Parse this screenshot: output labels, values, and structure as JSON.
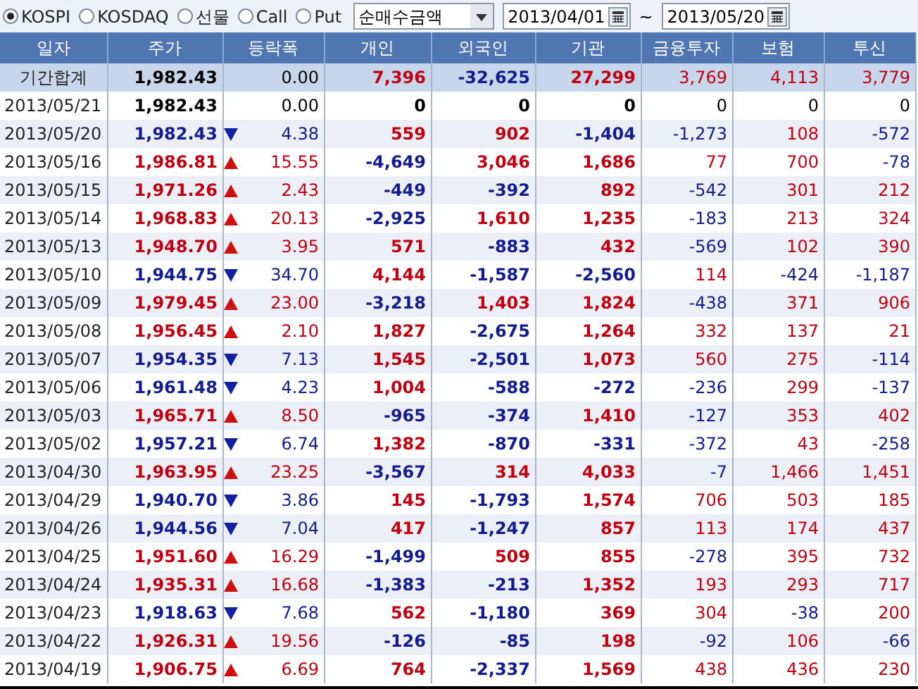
{
  "toolbar": {
    "markets": [
      {
        "label": "KOSPI",
        "selected": true
      },
      {
        "label": "KOSDAQ",
        "selected": false
      },
      {
        "label": "선물",
        "selected": false
      },
      {
        "label": "Call",
        "selected": false
      },
      {
        "label": "Put",
        "selected": false
      }
    ],
    "measure": {
      "value": "순매수금액"
    },
    "start_date": {
      "value": "2013/04/01"
    },
    "separator": "~",
    "end_date": {
      "value": "2013/05/20"
    }
  },
  "table": {
    "columns": [
      "일자",
      "주가",
      "등락폭",
      "개인",
      "외국인",
      "기관",
      "금융투자",
      "보험",
      "투신"
    ],
    "rows": [
      {
        "kind": "total",
        "date": "기간합계",
        "price": "1,982.43",
        "rising": false,
        "falling": false,
        "change": "0.00",
        "flows": [
          {
            "value": "7,396",
            "color": "#c00010"
          },
          {
            "value": "-32,625",
            "color": "#101c90"
          },
          {
            "value": "27,299",
            "color": "#c00010"
          },
          {
            "value": "3,769",
            "color": "#c00010"
          },
          {
            "value": "4,113",
            "color": "#c00010"
          },
          {
            "value": "3,779",
            "color": "#c00010"
          }
        ]
      },
      {
        "kind": "day",
        "date": "2013/05/21",
        "price": "1,982.43",
        "rising": false,
        "falling": false,
        "change": "0.00",
        "flows": [
          {
            "value": "0",
            "color": "#000000"
          },
          {
            "value": "0",
            "color": "#000000"
          },
          {
            "value": "0",
            "color": "#000000"
          },
          {
            "value": "0",
            "color": "#000000"
          },
          {
            "value": "0",
            "color": "#000000"
          },
          {
            "value": "0",
            "color": "#000000"
          }
        ]
      },
      {
        "kind": "day",
        "date": "2013/05/20",
        "price": "1,982.43",
        "rising": false,
        "falling": true,
        "change": "4.38",
        "flows": [
          {
            "value": "559",
            "color": "#c00010"
          },
          {
            "value": "902",
            "color": "#c00010"
          },
          {
            "value": "-1,404",
            "color": "#101c90"
          },
          {
            "value": "-1,273",
            "color": "#101c90"
          },
          {
            "value": "108",
            "color": "#c00010"
          },
          {
            "value": "-572",
            "color": "#101c90"
          }
        ]
      },
      {
        "kind": "day",
        "date": "2013/05/16",
        "price": "1,986.81",
        "rising": true,
        "falling": false,
        "change": "15.55",
        "flows": [
          {
            "value": "-4,649",
            "color": "#101c90"
          },
          {
            "value": "3,046",
            "color": "#c00010"
          },
          {
            "value": "1,686",
            "color": "#c00010"
          },
          {
            "value": "77",
            "color": "#c00010"
          },
          {
            "value": "700",
            "color": "#c00010"
          },
          {
            "value": "-78",
            "color": "#101c90"
          }
        ]
      },
      {
        "kind": "day",
        "date": "2013/05/15",
        "price": "1,971.26",
        "rising": true,
        "falling": false,
        "change": "2.43",
        "flows": [
          {
            "value": "-449",
            "color": "#101c90"
          },
          {
            "value": "-392",
            "color": "#101c90"
          },
          {
            "value": "892",
            "color": "#c00010"
          },
          {
            "value": "-542",
            "color": "#101c90"
          },
          {
            "value": "301",
            "color": "#c00010"
          },
          {
            "value": "212",
            "color": "#c00010"
          }
        ]
      },
      {
        "kind": "day",
        "date": "2013/05/14",
        "price": "1,968.83",
        "rising": true,
        "falling": false,
        "change": "20.13",
        "flows": [
          {
            "value": "-2,925",
            "color": "#101c90"
          },
          {
            "value": "1,610",
            "color": "#c00010"
          },
          {
            "value": "1,235",
            "color": "#c00010"
          },
          {
            "value": "-183",
            "color": "#101c90"
          },
          {
            "value": "213",
            "color": "#c00010"
          },
          {
            "value": "324",
            "color": "#c00010"
          }
        ]
      },
      {
        "kind": "day",
        "date": "2013/05/13",
        "price": "1,948.70",
        "rising": true,
        "falling": false,
        "change": "3.95",
        "flows": [
          {
            "value": "571",
            "color": "#c00010"
          },
          {
            "value": "-883",
            "color": "#101c90"
          },
          {
            "value": "432",
            "color": "#c00010"
          },
          {
            "value": "-569",
            "color": "#101c90"
          },
          {
            "value": "102",
            "color": "#c00010"
          },
          {
            "value": "390",
            "color": "#c00010"
          }
        ]
      },
      {
        "kind": "day",
        "date": "2013/05/10",
        "price": "1,944.75",
        "rising": false,
        "falling": true,
        "change": "34.70",
        "flows": [
          {
            "value": "4,144",
            "color": "#c00010"
          },
          {
            "value": "-1,587",
            "color": "#101c90"
          },
          {
            "value": "-2,560",
            "color": "#101c90"
          },
          {
            "value": "114",
            "color": "#c00010"
          },
          {
            "value": "-424",
            "color": "#101c90"
          },
          {
            "value": "-1,187",
            "color": "#101c90"
          }
        ]
      },
      {
        "kind": "day",
        "date": "2013/05/09",
        "price": "1,979.45",
        "rising": true,
        "falling": false,
        "change": "23.00",
        "flows": [
          {
            "value": "-3,218",
            "color": "#101c90"
          },
          {
            "value": "1,403",
            "color": "#c00010"
          },
          {
            "value": "1,824",
            "color": "#c00010"
          },
          {
            "value": "-438",
            "color": "#101c90"
          },
          {
            "value": "371",
            "color": "#c00010"
          },
          {
            "value": "906",
            "color": "#c00010"
          }
        ]
      },
      {
        "kind": "day",
        "date": "2013/05/08",
        "price": "1,956.45",
        "rising": true,
        "falling": false,
        "change": "2.10",
        "flows": [
          {
            "value": "1,827",
            "color": "#c00010"
          },
          {
            "value": "-2,675",
            "color": "#101c90"
          },
          {
            "value": "1,264",
            "color": "#c00010"
          },
          {
            "value": "332",
            "color": "#c00010"
          },
          {
            "value": "137",
            "color": "#c00010"
          },
          {
            "value": "21",
            "color": "#c00010"
          }
        ]
      },
      {
        "kind": "day",
        "date": "2013/05/07",
        "price": "1,954.35",
        "rising": false,
        "falling": true,
        "change": "7.13",
        "flows": [
          {
            "value": "1,545",
            "color": "#c00010"
          },
          {
            "value": "-2,501",
            "color": "#101c90"
          },
          {
            "value": "1,073",
            "color": "#c00010"
          },
          {
            "value": "560",
            "color": "#c00010"
          },
          {
            "value": "275",
            "color": "#c00010"
          },
          {
            "value": "-114",
            "color": "#101c90"
          }
        ]
      },
      {
        "kind": "day",
        "date": "2013/05/06",
        "price": "1,961.48",
        "rising": false,
        "falling": true,
        "change": "4.23",
        "flows": [
          {
            "value": "1,004",
            "color": "#c00010"
          },
          {
            "value": "-588",
            "color": "#101c90"
          },
          {
            "value": "-272",
            "color": "#101c90"
          },
          {
            "value": "-236",
            "color": "#101c90"
          },
          {
            "value": "299",
            "color": "#c00010"
          },
          {
            "value": "-137",
            "color": "#101c90"
          }
        ]
      },
      {
        "kind": "day",
        "date": "2013/05/03",
        "price": "1,965.71",
        "rising": true,
        "falling": false,
        "change": "8.50",
        "flows": [
          {
            "value": "-965",
            "color": "#101c90"
          },
          {
            "value": "-374",
            "color": "#101c90"
          },
          {
            "value": "1,410",
            "color": "#c00010"
          },
          {
            "value": "-127",
            "color": "#101c90"
          },
          {
            "value": "353",
            "color": "#c00010"
          },
          {
            "value": "402",
            "color": "#c00010"
          }
        ]
      },
      {
        "kind": "day",
        "date": "2013/05/02",
        "price": "1,957.21",
        "rising": false,
        "falling": true,
        "change": "6.74",
        "flows": [
          {
            "value": "1,382",
            "color": "#c00010"
          },
          {
            "value": "-870",
            "color": "#101c90"
          },
          {
            "value": "-331",
            "color": "#101c90"
          },
          {
            "value": "-372",
            "color": "#101c90"
          },
          {
            "value": "43",
            "color": "#c00010"
          },
          {
            "value": "-258",
            "color": "#101c90"
          }
        ]
      },
      {
        "kind": "day",
        "date": "2013/04/30",
        "price": "1,963.95",
        "rising": true,
        "falling": false,
        "change": "23.25",
        "flows": [
          {
            "value": "-3,567",
            "color": "#101c90"
          },
          {
            "value": "314",
            "color": "#c00010"
          },
          {
            "value": "4,033",
            "color": "#c00010"
          },
          {
            "value": "-7",
            "color": "#101c90"
          },
          {
            "value": "1,466",
            "color": "#c00010"
          },
          {
            "value": "1,451",
            "color": "#c00010"
          }
        ]
      },
      {
        "kind": "day",
        "date": "2013/04/29",
        "price": "1,940.70",
        "rising": false,
        "falling": true,
        "change": "3.86",
        "flows": [
          {
            "value": "145",
            "color": "#c00010"
          },
          {
            "value": "-1,793",
            "color": "#101c90"
          },
          {
            "value": "1,574",
            "color": "#c00010"
          },
          {
            "value": "706",
            "color": "#c00010"
          },
          {
            "value": "503",
            "color": "#c00010"
          },
          {
            "value": "185",
            "color": "#c00010"
          }
        ]
      },
      {
        "kind": "day",
        "date": "2013/04/26",
        "price": "1,944.56",
        "rising": false,
        "falling": true,
        "change": "7.04",
        "flows": [
          {
            "value": "417",
            "color": "#c00010"
          },
          {
            "value": "-1,247",
            "color": "#101c90"
          },
          {
            "value": "857",
            "color": "#c00010"
          },
          {
            "value": "113",
            "color": "#c00010"
          },
          {
            "value": "174",
            "color": "#c00010"
          },
          {
            "value": "437",
            "color": "#c00010"
          }
        ]
      },
      {
        "kind": "day",
        "date": "2013/04/25",
        "price": "1,951.60",
        "rising": true,
        "falling": false,
        "change": "16.29",
        "flows": [
          {
            "value": "-1,499",
            "color": "#101c90"
          },
          {
            "value": "509",
            "color": "#c00010"
          },
          {
            "value": "855",
            "color": "#c00010"
          },
          {
            "value": "-278",
            "color": "#101c90"
          },
          {
            "value": "395",
            "color": "#c00010"
          },
          {
            "value": "732",
            "color": "#c00010"
          }
        ]
      },
      {
        "kind": "day",
        "date": "2013/04/24",
        "price": "1,935.31",
        "rising": true,
        "falling": false,
        "change": "16.68",
        "flows": [
          {
            "value": "-1,383",
            "color": "#101c90"
          },
          {
            "value": "-213",
            "color": "#101c90"
          },
          {
            "value": "1,352",
            "color": "#c00010"
          },
          {
            "value": "193",
            "color": "#c00010"
          },
          {
            "value": "293",
            "color": "#c00010"
          },
          {
            "value": "717",
            "color": "#c00010"
          }
        ]
      },
      {
        "kind": "day",
        "date": "2013/04/23",
        "price": "1,918.63",
        "rising": false,
        "falling": true,
        "change": "7.68",
        "flows": [
          {
            "value": "562",
            "color": "#c00010"
          },
          {
            "value": "-1,180",
            "color": "#101c90"
          },
          {
            "value": "369",
            "color": "#c00010"
          },
          {
            "value": "304",
            "color": "#c00010"
          },
          {
            "value": "-38",
            "color": "#101c90"
          },
          {
            "value": "200",
            "color": "#c00010"
          }
        ]
      },
      {
        "kind": "day",
        "date": "2013/04/22",
        "price": "1,926.31",
        "rising": true,
        "falling": false,
        "change": "19.56",
        "flows": [
          {
            "value": "-126",
            "color": "#101c90"
          },
          {
            "value": "-85",
            "color": "#101c90"
          },
          {
            "value": "198",
            "color": "#c00010"
          },
          {
            "value": "-92",
            "color": "#101c90"
          },
          {
            "value": "106",
            "color": "#c00010"
          },
          {
            "value": "-66",
            "color": "#101c90"
          }
        ]
      },
      {
        "kind": "day",
        "date": "2013/04/19",
        "price": "1,906.75",
        "rising": true,
        "falling": false,
        "change": "6.69",
        "flows": [
          {
            "value": "764",
            "color": "#c00010"
          },
          {
            "value": "-2,337",
            "color": "#101c90"
          },
          {
            "value": "1,569",
            "color": "#c00010"
          },
          {
            "value": "438",
            "color": "#c00010"
          },
          {
            "value": "436",
            "color": "#c00010"
          },
          {
            "value": "230",
            "color": "#c00010"
          }
        ]
      }
    ]
  }
}
